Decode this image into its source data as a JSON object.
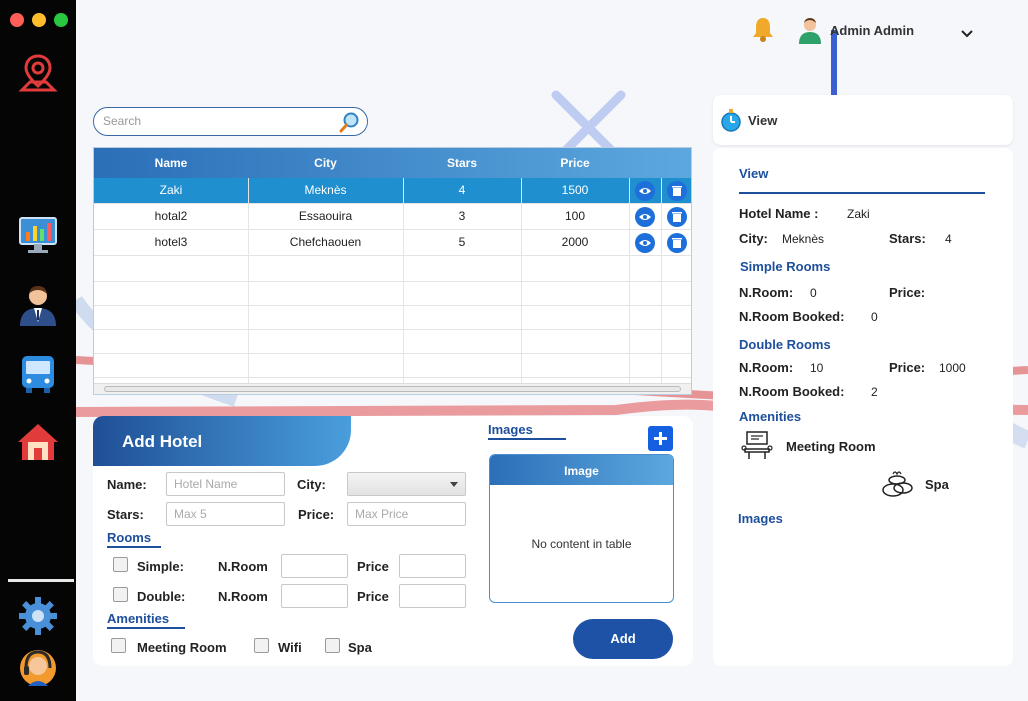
{
  "window": {
    "colors": {
      "close": "#ff5f57",
      "minimize": "#ffbd2e",
      "maximize": "#28c940"
    }
  },
  "sidebar": {
    "items": [
      {
        "name": "map-pin-icon"
      },
      {
        "name": "dashboard-icon"
      },
      {
        "name": "user-icon"
      },
      {
        "name": "bus-icon"
      },
      {
        "name": "home-icon"
      },
      {
        "name": "settings-gear-icon"
      },
      {
        "name": "support-avatar-icon"
      }
    ]
  },
  "header": {
    "user_name": "Admin Admin"
  },
  "search": {
    "placeholder": "Search"
  },
  "table": {
    "columns": [
      "Name",
      "City",
      "Stars",
      "Price"
    ],
    "rows": [
      {
        "name": "Zaki",
        "city": "Meknès",
        "stars": "4",
        "price": "1500",
        "selected": true
      },
      {
        "name": "hotal2",
        "city": "Essaouira",
        "stars": "3",
        "price": "100",
        "selected": false
      },
      {
        "name": "hotel3",
        "city": "Chefchaouen",
        "stars": "5",
        "price": "2000",
        "selected": false
      }
    ]
  },
  "add_hotel": {
    "title": "Add Hotel",
    "name_label": "Name:",
    "name_placeholder": "Hotel Name",
    "city_label": "City:",
    "stars_label": "Stars:",
    "stars_placeholder": "Max 5",
    "price_label": "Price:",
    "price_placeholder": "Max Price",
    "rooms_section": "Rooms",
    "simple_label": "Simple:",
    "double_label": "Double:",
    "nroom_label": "N.Room",
    "room_price_label": "Price",
    "amenities_section": "Amenities",
    "amenities": [
      "Meeting Room",
      "Wifi",
      "Spa"
    ],
    "images_section": "Images",
    "image_column": "Image",
    "image_empty": "No content in table",
    "add_button": "Add"
  },
  "view": {
    "header": "View",
    "title": "View",
    "hotel_name_label": "Hotel Name :",
    "hotel_name": "Zaki",
    "city_label": "City:",
    "city": "Meknès",
    "stars_label": "Stars:",
    "stars": "4",
    "simple_rooms_title": "Simple Rooms",
    "simple_nroom_label": "N.Room:",
    "simple_nroom": "0",
    "simple_price_label": "Price:",
    "simple_price": "",
    "simple_booked_label": "N.Room Booked:",
    "simple_booked": "0",
    "double_rooms_title": "Double Rooms",
    "double_nroom_label": "N.Room:",
    "double_nroom": "10",
    "double_price_label": "Price:",
    "double_price": "1000",
    "double_booked_label": "N.Room Booked:",
    "double_booked": "2",
    "amenities_title": "Amenities",
    "amenities": [
      "Meeting Room",
      "Spa"
    ],
    "images_title": "Images"
  }
}
